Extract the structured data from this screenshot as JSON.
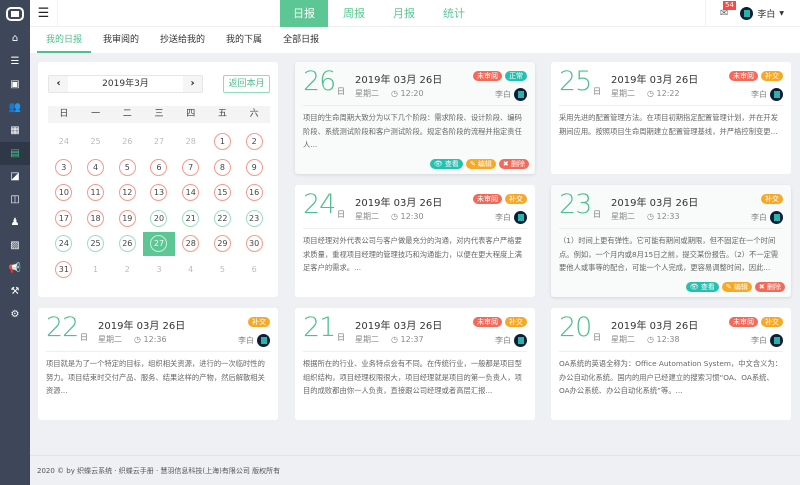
{
  "sidebar": {
    "items": [
      {
        "icon": "home-icon",
        "glyph": "⌂"
      },
      {
        "icon": "list-icon",
        "glyph": "☰"
      },
      {
        "icon": "briefcase-icon",
        "glyph": "▣"
      },
      {
        "icon": "users-icon",
        "glyph": "👥"
      },
      {
        "icon": "calendar-icon",
        "glyph": "▦"
      },
      {
        "icon": "report-icon",
        "glyph": "▤",
        "active": true
      },
      {
        "icon": "eraser-icon",
        "glyph": "◪"
      },
      {
        "icon": "columns-icon",
        "glyph": "◫"
      },
      {
        "icon": "person-icon",
        "glyph": "♟"
      },
      {
        "icon": "image-icon",
        "glyph": "▨"
      },
      {
        "icon": "megaphone-icon",
        "glyph": "📢"
      },
      {
        "icon": "gavel-icon",
        "glyph": "⚒"
      },
      {
        "icon": "settings-icon",
        "glyph": "⚙"
      }
    ]
  },
  "header": {
    "tabs": [
      {
        "label": "日报",
        "active": true
      },
      {
        "label": "周报"
      },
      {
        "label": "月报"
      },
      {
        "label": "统计"
      }
    ],
    "mail_count": "54",
    "user": "李白"
  },
  "subtabs": [
    {
      "label": "我的日报",
      "active": true
    },
    {
      "label": "我审阅的"
    },
    {
      "label": "抄送给我的"
    },
    {
      "label": "我的下属"
    },
    {
      "label": "全部日报"
    }
  ],
  "calendar": {
    "month": "2019年3月",
    "back_label": "返回本月",
    "weekdays": [
      "日",
      "一",
      "二",
      "三",
      "四",
      "五",
      "六"
    ],
    "prev_days": [
      24,
      25,
      26,
      27,
      28
    ],
    "next_days": [
      1,
      2,
      3,
      4,
      5,
      6
    ],
    "days_in_month": 31,
    "submitted_days": [
      20,
      21,
      22,
      23,
      24,
      25,
      26
    ],
    "selected_day": 27,
    "colors": {
      "missing": "#f49a8f",
      "submitted": "#9adfc1",
      "selected": "#5cc794"
    }
  },
  "reports": [
    {
      "day": "26",
      "day_unit": "日",
      "date": "2019年 03月 26日",
      "weekday": "星期二",
      "time": "12:20",
      "author": "李白",
      "tags": [
        {
          "label": "未审阅",
          "color": "red"
        },
        {
          "label": "正常",
          "color": "teal"
        }
      ],
      "text": "项目的生命周期大致分为以下几个阶段：需求阶段、设计阶段、编码阶段、系统测试阶段和客户测试阶段。规定各阶段的流程并指定责任人...",
      "actions": true
    },
    {
      "day": "25",
      "day_unit": "日",
      "date": "2019年 03月 26日",
      "weekday": "星期二",
      "time": "12:22",
      "author": "李白",
      "tags": [
        {
          "label": "未审阅",
          "color": "red"
        },
        {
          "label": "补交",
          "color": "orange"
        }
      ],
      "text": "采用先进的配置管理方法。在项目初期指定配置管理计划，并在开发期间应用。按照项目生命周期建立配置管理基线，并严格控制变更..."
    },
    {
      "day": "24",
      "day_unit": "日",
      "date": "2019年 03月 26日",
      "weekday": "星期二",
      "time": "12:30",
      "author": "李白",
      "tags": [
        {
          "label": "未审阅",
          "color": "red"
        },
        {
          "label": "补交",
          "color": "orange"
        }
      ],
      "text": "项目经理对外代表公司与客户做最充分的沟通，对内代表客户严格要求质量，重视项目经理的管理技巧和沟通能力，以便在更大程度上满足客户的需求。..."
    },
    {
      "day": "23",
      "day_unit": "日",
      "date": "2019年 03月 26日",
      "weekday": "星期二",
      "time": "12:33",
      "author": "李白",
      "tags": [
        {
          "label": "补交",
          "color": "orange"
        }
      ],
      "text": "（1）时间上更有弹性。它可能有期间或期限，但不固定在一个时间点。例如，一个月内或8月15日之前，提交某份报告。（2）不一定需要他人或事等的配合，可能一个人完成，更容易调整时间，因此...",
      "actions": true
    },
    {
      "day": "22",
      "day_unit": "日",
      "date": "2019年 03月 26日",
      "weekday": "星期二",
      "time": "12:36",
      "author": "李白",
      "tags": [
        {
          "label": "补交",
          "color": "orange"
        }
      ],
      "text": "项目就是为了一个特定的目标，组织相关资源，进行的一次临时性的努力。项目结束时交付产品、服务、结果这样的产物，然后解散相关资源..."
    },
    {
      "day": "21",
      "day_unit": "日",
      "date": "2019年 03月 26日",
      "weekday": "星期二",
      "time": "12:37",
      "author": "李白",
      "tags": [
        {
          "label": "未审阅",
          "color": "red"
        },
        {
          "label": "补交",
          "color": "orange"
        }
      ],
      "text": "根据所在的行业、业务特点会有不同。在传统行业，一般都是项目型组织结构，项目经理权限很大，项目经理就是项目的第一负责人，项目的成败都由你一人负责，直接跟公司经理或者高层汇报..."
    },
    {
      "day": "20",
      "day_unit": "日",
      "date": "2019年 03月 26日",
      "weekday": "星期二",
      "time": "12:38",
      "author": "李白",
      "tags": [
        {
          "label": "未审阅",
          "color": "red"
        },
        {
          "label": "补交",
          "color": "orange"
        }
      ],
      "text": "OA系统的英语全称为：Office Automation System，中文含义为：办公自动化系统。国内的用户已经建立的搜索习惯“OA、OA系统、OA办公系统、办公自动化系统”等。..."
    }
  ],
  "actions": {
    "view": "查看",
    "edit": "编辑",
    "delete": "删除"
  },
  "footer": "2020 © by 织蝶云系统 · 织蝶云手册 · 慧羽信息科技(上海)有限公司 版权所有"
}
